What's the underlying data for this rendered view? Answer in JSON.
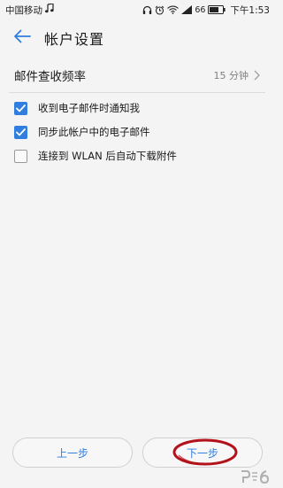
{
  "status_bar": {
    "carrier": "中国移动",
    "battery_percent": "66",
    "time": "下午1:53",
    "icons": [
      "music-note-icon",
      "headphones-icon",
      "alarm-icon",
      "wifi-icon",
      "signal-icon",
      "battery-icon"
    ]
  },
  "app_bar": {
    "back_icon": "arrow-left-icon",
    "title": "帐户设置"
  },
  "settings": {
    "frequency": {
      "label": "邮件查收频率",
      "value": "15 分钟"
    },
    "options": [
      {
        "label": "收到电子邮件时通知我",
        "checked": true
      },
      {
        "label": "同步此帐户中的电子邮件",
        "checked": true
      },
      {
        "label": "连接到 WLAN 后自动下载附件",
        "checked": false
      }
    ]
  },
  "buttons": {
    "prev_label": "上一步",
    "next_label": "下一步"
  },
  "colors": {
    "accent": "#2f7ee0",
    "background": "#f4f4f4",
    "annotation": "#b3121a"
  }
}
